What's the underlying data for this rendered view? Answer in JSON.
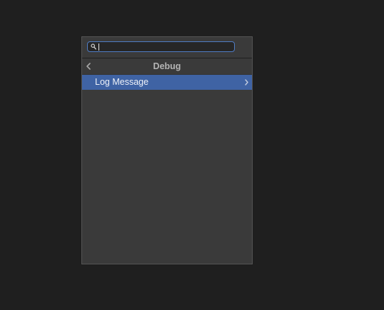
{
  "search": {
    "value": "",
    "placeholder": ""
  },
  "header": {
    "title": "Debug",
    "back_icon": "chevron-left-icon"
  },
  "items": [
    {
      "label": "Log Message",
      "selected": true,
      "trailing_icon": "chevron-right-icon"
    }
  ],
  "colors": {
    "background": "#1f1f1f",
    "panel": "#3a3a3a",
    "selection": "#3f63a4",
    "focus_ring": "#4f7cc4"
  }
}
